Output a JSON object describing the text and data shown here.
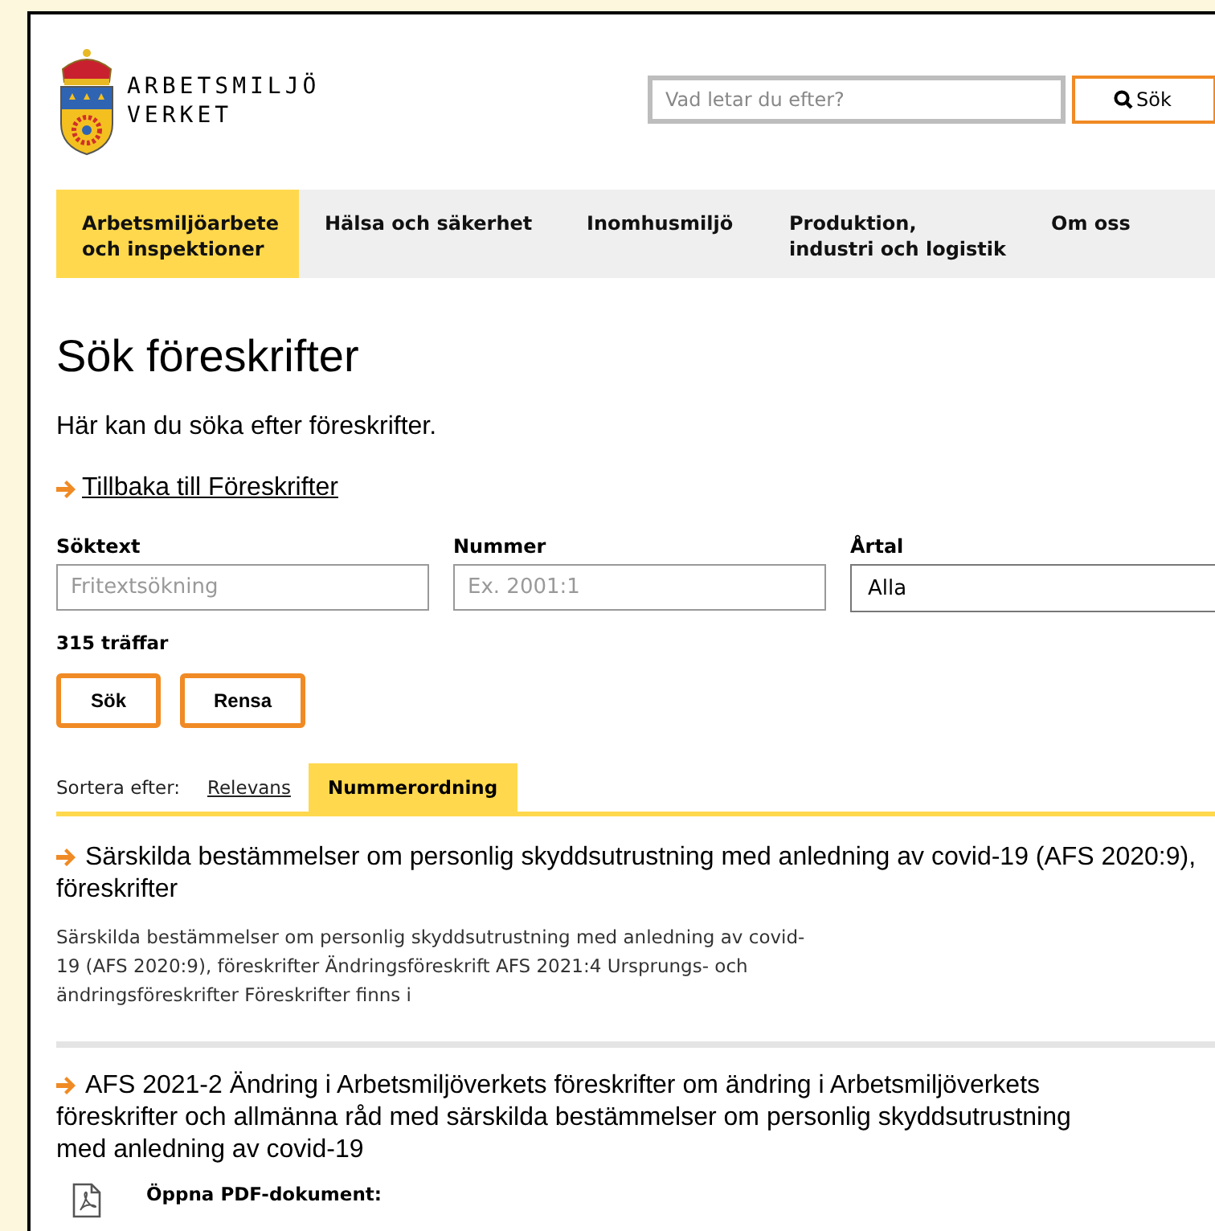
{
  "header": {
    "logo_lines": [
      "ARBETSMILJÖ",
      "VERKET"
    ],
    "search": {
      "placeholder": "Vad letar du efter?"
    },
    "search_button": "Sök"
  },
  "nav": [
    {
      "label": "Arbetsmiljöarbete\noch inspektioner",
      "selected": true
    },
    {
      "label": "Hälsa och säkerhet",
      "selected": false
    },
    {
      "label": "Inomhusmiljö",
      "selected": false
    },
    {
      "label": "Produktion,\nindustri och logistik",
      "selected": false
    },
    {
      "label": "Om oss",
      "selected": false
    }
  ],
  "page": {
    "title": "Sök föreskrifter",
    "intro": "Här kan du söka efter föreskrifter.",
    "back_link": "Tillbaka till Föreskrifter"
  },
  "form": {
    "fields": [
      {
        "label": "Söktext",
        "kind": "text",
        "placeholder": "Fritextsökning"
      },
      {
        "label": "Nummer",
        "kind": "text",
        "placeholder": "Ex. 2001:1"
      },
      {
        "label": "Årtal",
        "kind": "select",
        "value": "Alla"
      }
    ],
    "hits": "315 träffar",
    "buttons": [
      "Sök",
      "Rensa"
    ]
  },
  "sort": {
    "label": "Sortera efter:",
    "options": [
      {
        "label": "Relevans",
        "selected": false
      },
      {
        "label": "Nummerordning",
        "selected": true
      }
    ]
  },
  "results": [
    {
      "kind": "snippet",
      "title": "Särskilda bestämmelser om personlig skyddsutrustning med anledning av covid-19 (AFS 2020:9),\nföreskrifter",
      "text": "Särskilda bestämmelser om personlig skyddsutrustning med anledning av covid-\n19 (AFS 2020:9), föreskrifter Ändringsföreskrift AFS 2021:4 Ursprungs- och\nändringsföreskrifter Föreskrifter finns i"
    },
    {
      "kind": "pdf",
      "title": "AFS 2021-2 Ändring i Arbetsmiljöverkets föreskrifter om ändring i Arbetsmiljöverkets\nföreskrifter och allmänna råd med särskilda bestämmelser om personlig skyddsutrustning\nmed anledning av covid-19",
      "text": "Öppna PDF-dokument:"
    }
  ]
}
